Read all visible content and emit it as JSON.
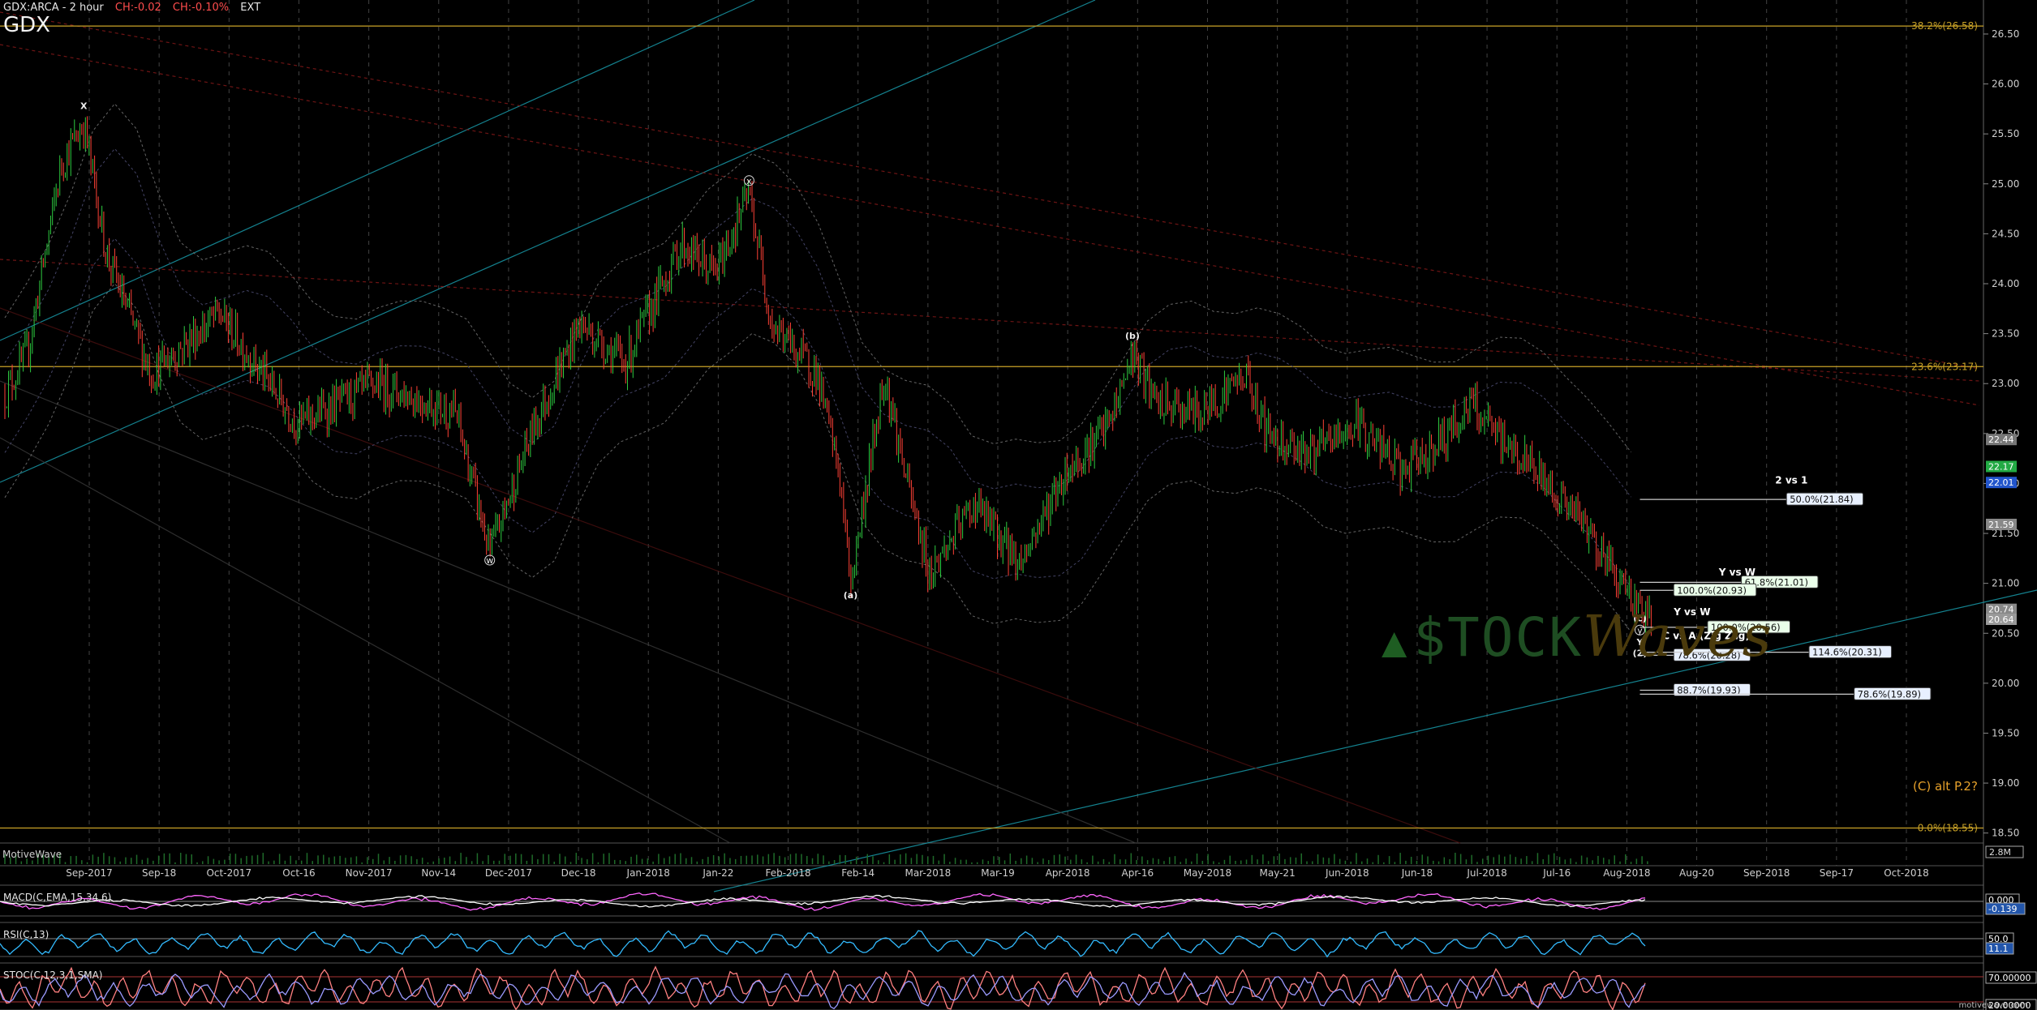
{
  "header": {
    "symbol_line": "GDX:ARCA - 2 hour",
    "change_abs": "CH:-0.02",
    "change_pct": "CH:-0.10%",
    "session": "EXT",
    "ticker": "GDX"
  },
  "colors": {
    "background": "#000000",
    "fib_line": "#c9a227",
    "up_candle": "#2ecc40",
    "down_candle": "#ff4136",
    "trend_teal": "#1aa3b3",
    "trend_red": "#a01818",
    "macd": "#ff66ff",
    "rsi": "#33bbff",
    "stoch": "#ff8080"
  },
  "watermark": {
    "text": "$TOCK",
    "accent": "Waves"
  },
  "footer_label": "MotiveWave",
  "chart_data": {
    "type": "candlestick",
    "title": "GDX",
    "ylim": [
      18.4,
      26.8
    ],
    "y_ticks": [
      "26.50",
      "26.00",
      "25.50",
      "25.00",
      "24.50",
      "24.00",
      "23.50",
      "23.00",
      "22.50",
      "22.00",
      "21.50",
      "21.00",
      "20.50",
      "20.00",
      "19.50",
      "19.00",
      "18.50"
    ],
    "x_labels": [
      "Sep-2017",
      "Sep-18",
      "Oct-2017",
      "Oct-16",
      "Nov-2017",
      "Nov-14",
      "Dec-2017",
      "Dec-18",
      "Jan-2018",
      "Jan-22",
      "Feb-2018",
      "Feb-14",
      "Mar-2018",
      "Mar-19",
      "Apr-2018",
      "Apr-16",
      "May-2018",
      "May-21",
      "Jun-2018",
      "Jun-18",
      "Jul-2018",
      "Jul-16",
      "Aug-2018",
      "Aug-20",
      "Sep-2018",
      "Sep-17",
      "Oct-2018"
    ],
    "price_path": [
      [
        0,
        22.9
      ],
      [
        2,
        23.3
      ],
      [
        5,
        25.2
      ],
      [
        7,
        25.6
      ],
      [
        9,
        24.3
      ],
      [
        13,
        23.1
      ],
      [
        19,
        23.7
      ],
      [
        26,
        22.6
      ],
      [
        33,
        23.0
      ],
      [
        40,
        22.7
      ],
      [
        43,
        21.3
      ],
      [
        47,
        22.6
      ],
      [
        51,
        23.6
      ],
      [
        55,
        23.2
      ],
      [
        60,
        24.4
      ],
      [
        63,
        24.1
      ],
      [
        66,
        24.9
      ],
      [
        68,
        23.6
      ],
      [
        72,
        23.1
      ],
      [
        74,
        22.1
      ],
      [
        75,
        21.0
      ],
      [
        78,
        23.1
      ],
      [
        80,
        22.0
      ],
      [
        82,
        21.1
      ],
      [
        86,
        21.8
      ],
      [
        90,
        21.2
      ],
      [
        94,
        22.1
      ],
      [
        98,
        22.6
      ],
      [
        100,
        23.3
      ],
      [
        102,
        22.8
      ],
      [
        106,
        22.7
      ],
      [
        110,
        23.1
      ],
      [
        112,
        22.5
      ],
      [
        116,
        22.3
      ],
      [
        120,
        22.6
      ],
      [
        124,
        22.1
      ],
      [
        128,
        22.5
      ],
      [
        130,
        22.8
      ],
      [
        132,
        22.5
      ],
      [
        136,
        22.1
      ],
      [
        140,
        21.6
      ],
      [
        144,
        20.9
      ],
      [
        146,
        20.62
      ]
    ],
    "fib_levels": [
      {
        "label": "38.2%(26.58)",
        "value": 26.58
      },
      {
        "label": "23.6%(23.17)",
        "value": 23.17
      },
      {
        "label": "0.0%(18.55)",
        "value": 18.55
      }
    ],
    "price_tags": [
      {
        "text": "22.44",
        "value": 22.44,
        "color": "#777777"
      },
      {
        "text": "22.17",
        "value": 22.17,
        "color": "#22aa44"
      },
      {
        "text": "22.01",
        "value": 22.01,
        "color": "#2255cc"
      },
      {
        "text": "21.59",
        "value": 21.59,
        "color": "#888888"
      },
      {
        "text": "20.74",
        "value": 20.74,
        "color": "#888888"
      },
      {
        "text": "20.64",
        "value": 20.64,
        "color": "#999999"
      }
    ],
    "projections": [
      {
        "label": "50.0%(21.84)",
        "value": 21.84,
        "style": "blue",
        "x0": 145,
        "x1": 158
      },
      {
        "label": "61.8%(21.01)",
        "value": 21.01,
        "style": "green",
        "x0": 145,
        "x1": 154
      },
      {
        "label": "100.0%(20.93)",
        "value": 20.93,
        "style": "green",
        "x0": 145,
        "x1": 148
      },
      {
        "label": "100.0%(20.56)",
        "value": 20.56,
        "style": "green",
        "x0": 145,
        "x1": 151
      },
      {
        "label": "78.6%(20.28)",
        "value": 20.28,
        "style": "blue",
        "x0": 145,
        "x1": 148
      },
      {
        "label": "114.6%(20.31)",
        "value": 20.31,
        "style": "blue",
        "x0": 145,
        "x1": 160
      },
      {
        "label": "88.7%(19.93)",
        "value": 19.93,
        "style": "blue",
        "x0": 145,
        "x1": 148
      },
      {
        "label": "78.6%(19.89)",
        "value": 19.89,
        "style": "blue",
        "x0": 145,
        "x1": 164
      }
    ],
    "projection_titles": [
      {
        "text": "2 vs 1",
        "x": 157,
        "y": 22.0
      },
      {
        "text": "Y vs W",
        "x": 152,
        "y": 21.08
      },
      {
        "text": "Y vs W",
        "x": 148,
        "y": 20.68
      },
      {
        "text": "C vs A (Zig Zag)",
        "x": 147,
        "y": 20.44
      }
    ],
    "wave_labels": [
      {
        "text": "X",
        "x": 7,
        "y": 25.75,
        "circle": false
      },
      {
        "text": "x",
        "x": 66,
        "y": 25.0,
        "circle": true
      },
      {
        "text": "w",
        "x": 43,
        "y": 21.2,
        "circle": true
      },
      {
        "text": "(a)",
        "x": 75,
        "y": 20.85,
        "circle": false
      },
      {
        "text": "(b)",
        "x": 100,
        "y": 23.45,
        "circle": false
      },
      {
        "text": "(c)",
        "x": 145,
        "y": 20.62,
        "circle": false
      },
      {
        "text": "y",
        "x": 145,
        "y": 20.5,
        "circle": true
      },
      {
        "text": "Y",
        "x": 145,
        "y": 20.38,
        "circle": false
      },
      {
        "text": "(2)",
        "x": 145,
        "y": 20.27,
        "circle": false
      }
    ],
    "alt_label": "(C) alt P.2?",
    "volume_tag": "2.8M",
    "indicators": [
      {
        "name": "MACD(C,EMA,15,34,6)",
        "tags": [
          "0.000",
          "-0.139"
        ]
      },
      {
        "name": "RSI(C,13)",
        "tags": [
          "50.0",
          "11.1"
        ]
      },
      {
        "name": "STOC(C,12,3,1,SMA)",
        "tags": [
          "70.00000",
          "20.00000"
        ]
      }
    ],
    "site_label": "motivewave.com"
  }
}
